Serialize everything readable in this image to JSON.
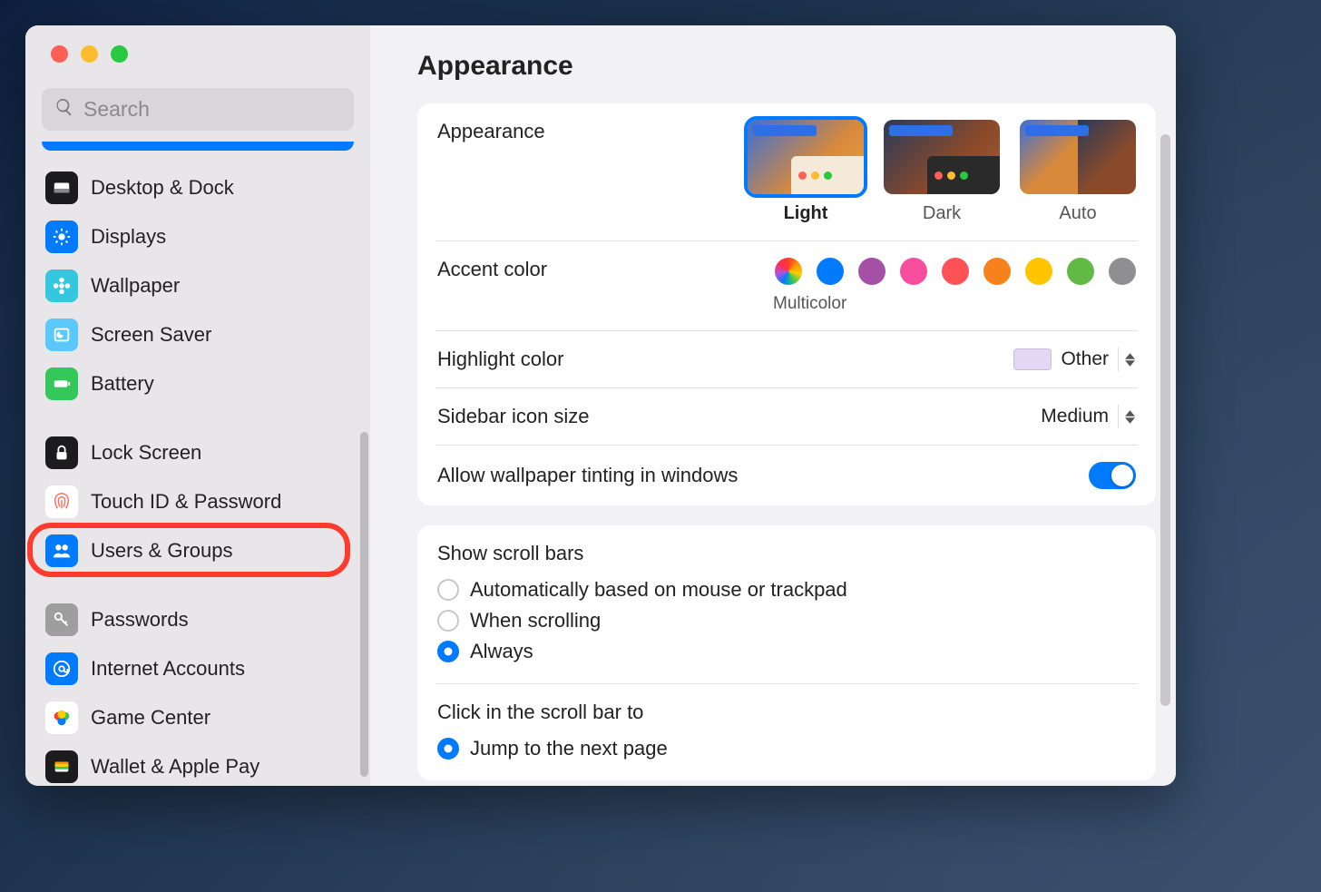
{
  "search": {
    "placeholder": "Search"
  },
  "sidebar": {
    "groups": [
      [
        {
          "id": "desktop-dock",
          "label": "Desktop & Dock",
          "bg": "#1c1c1e",
          "icon": "dock"
        },
        {
          "id": "displays",
          "label": "Displays",
          "bg": "#007aff",
          "icon": "sun"
        },
        {
          "id": "wallpaper",
          "label": "Wallpaper",
          "bg": "#34c8de",
          "icon": "flower"
        },
        {
          "id": "screen-saver",
          "label": "Screen Saver",
          "bg": "#5ac8fa",
          "icon": "moon"
        },
        {
          "id": "battery",
          "label": "Battery",
          "bg": "#34c759",
          "icon": "battery"
        }
      ],
      [
        {
          "id": "lock-screen",
          "label": "Lock Screen",
          "bg": "#1c1c1e",
          "icon": "lock"
        },
        {
          "id": "touch-id",
          "label": "Touch ID & Password",
          "bg": "#ffffff",
          "icon": "fingerprint"
        },
        {
          "id": "users-groups",
          "label": "Users & Groups",
          "bg": "#007aff",
          "icon": "people",
          "highlighted": true
        }
      ],
      [
        {
          "id": "passwords",
          "label": "Passwords",
          "bg": "#9e9e9e",
          "icon": "key"
        },
        {
          "id": "internet-accounts",
          "label": "Internet Accounts",
          "bg": "#007aff",
          "icon": "at"
        },
        {
          "id": "game-center",
          "label": "Game Center",
          "bg": "#ffffff",
          "icon": "gamecenter"
        },
        {
          "id": "wallet",
          "label": "Wallet & Apple Pay",
          "bg": "#1c1c1e",
          "icon": "wallet"
        }
      ]
    ]
  },
  "main": {
    "title": "Appearance",
    "appearance": {
      "label": "Appearance",
      "options": [
        {
          "label": "Light",
          "selected": true
        },
        {
          "label": "Dark",
          "selected": false
        },
        {
          "label": "Auto",
          "selected": false
        }
      ]
    },
    "accent": {
      "label": "Accent color",
      "sublabel": "Multicolor",
      "colors": [
        "multi",
        "#007aff",
        "#a550a7",
        "#f74f9e",
        "#ff5257",
        "#f7821b",
        "#ffc600",
        "#62ba46",
        "#8e8e93"
      ]
    },
    "highlight": {
      "label": "Highlight color",
      "value": "Other"
    },
    "sidebar_size": {
      "label": "Sidebar icon size",
      "value": "Medium"
    },
    "tinting": {
      "label": "Allow wallpaper tinting in windows",
      "value": true
    },
    "scrollbars": {
      "label": "Show scroll bars",
      "options": [
        {
          "label": "Automatically based on mouse or trackpad",
          "checked": false
        },
        {
          "label": "When scrolling",
          "checked": false
        },
        {
          "label": "Always",
          "checked": true
        }
      ]
    },
    "scrollclick": {
      "label": "Click in the scroll bar to",
      "options": [
        {
          "label": "Jump to the next page",
          "checked": true
        }
      ]
    }
  }
}
